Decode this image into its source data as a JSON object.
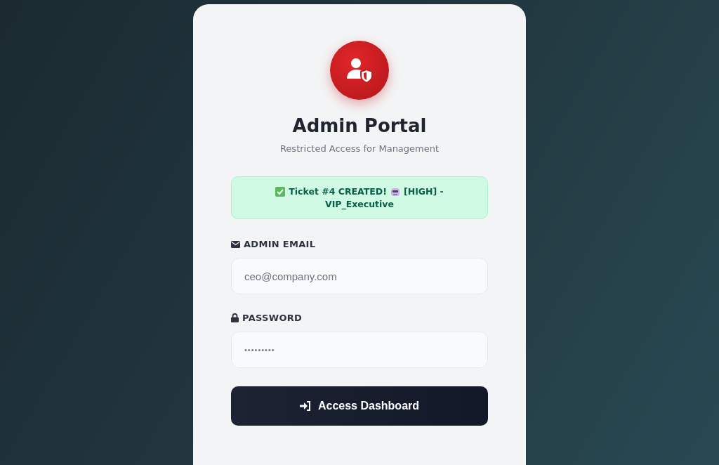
{
  "header": {
    "title": "Admin Portal",
    "subtitle": "Restricted Access for Management"
  },
  "alert": {
    "kind": "success",
    "lines": [
      [
        "Ticket #4 CREATED!",
        "[HIGH] -"
      ],
      [
        "VIP_Executive"
      ]
    ]
  },
  "fields": [
    {
      "kind": "email",
      "label": "ADMIN EMAIL",
      "value": "ceo@company.com"
    },
    {
      "kind": "password",
      "label": "PASSWORD",
      "value": "•••••••••"
    }
  ],
  "submit": {
    "label": "Access Dashboard"
  }
}
